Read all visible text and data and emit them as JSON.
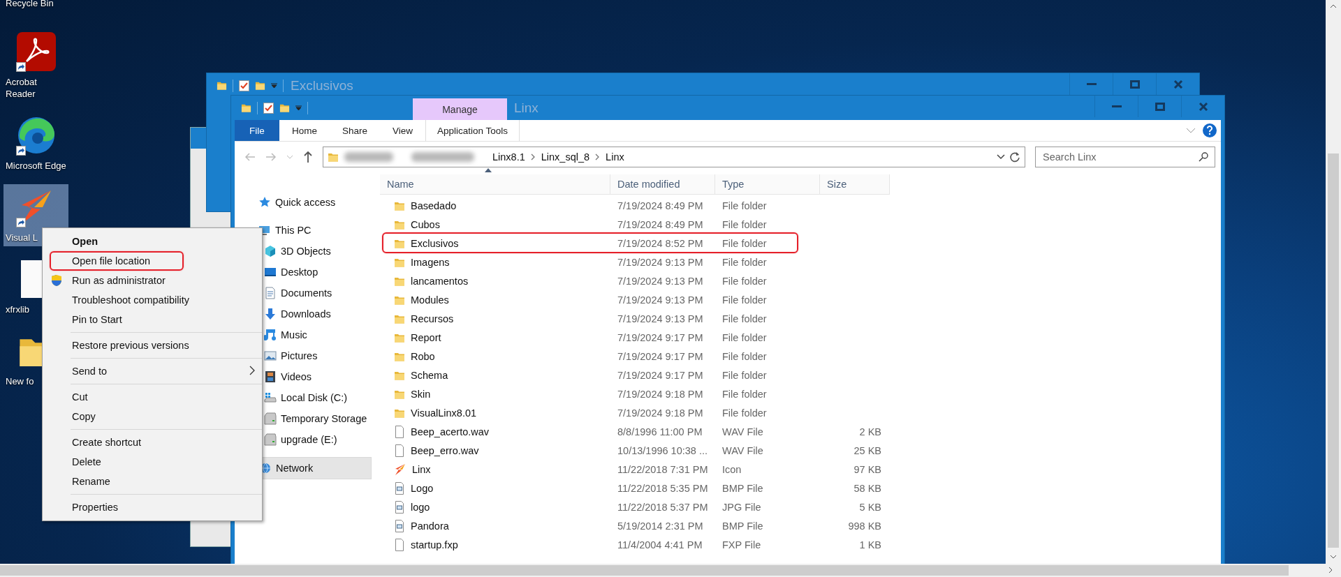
{
  "desktop": {
    "icons": [
      {
        "label": "Recycle Bin",
        "kind": "recycle",
        "selected": false
      },
      {
        "label": "Acrobat Reader",
        "kind": "acrobat",
        "selected": false
      },
      {
        "label": "Microsoft Edge",
        "kind": "edge",
        "selected": false
      },
      {
        "label": "Visual L",
        "kind": "linx",
        "selected": true
      },
      {
        "label": "xfrxlib",
        "kind": "file",
        "selected": false
      },
      {
        "label": "New fo",
        "kind": "folder",
        "selected": false
      }
    ]
  },
  "back_window": {
    "title": "Exclusivos"
  },
  "window": {
    "title": "Linx",
    "context_label": "Manage",
    "tabs": [
      {
        "label": "File",
        "kind": "file"
      },
      {
        "label": "Home",
        "kind": "tab"
      },
      {
        "label": "Share",
        "kind": "tab"
      },
      {
        "label": "View",
        "kind": "tab"
      },
      {
        "label": "Application Tools",
        "kind": "context"
      }
    ],
    "address": {
      "path": [
        "Linx8.1",
        "Linx_sql_8",
        "Linx"
      ]
    },
    "search": {
      "placeholder": "Search Linx"
    },
    "nav": [
      {
        "label": "Quick access",
        "kind": "star",
        "selected": false
      },
      {
        "label": "This PC",
        "kind": "pc",
        "selected": false,
        "children": [
          {
            "label": "3D Objects",
            "kind": "cube",
            "selected": false
          },
          {
            "label": "Desktop",
            "kind": "desktop",
            "selected": false
          },
          {
            "label": "Documents",
            "kind": "documents",
            "selected": false
          },
          {
            "label": "Downloads",
            "kind": "downloads",
            "selected": false
          },
          {
            "label": "Music",
            "kind": "music",
            "selected": false
          },
          {
            "label": "Pictures",
            "kind": "pictures",
            "selected": false
          },
          {
            "label": "Videos",
            "kind": "videos",
            "selected": false
          },
          {
            "label": "Local Disk (C:)",
            "kind": "windrive",
            "selected": false
          },
          {
            "label": "Temporary Storage",
            "kind": "drive",
            "selected": false
          },
          {
            "label": "upgrade (E:)",
            "kind": "drive",
            "selected": false
          }
        ]
      },
      {
        "label": "Network",
        "kind": "network",
        "selected": true
      }
    ],
    "table": {
      "columns": [
        "Name",
        "Date modified",
        "Type",
        "Size"
      ],
      "rows": [
        {
          "name": "Basedado",
          "date": "7/19/2024 8:49 PM",
          "type": "File folder",
          "kind": "folder",
          "highlighted": false
        },
        {
          "name": "Cubos",
          "date": "7/19/2024 8:49 PM",
          "type": "File folder",
          "kind": "folder",
          "highlighted": false
        },
        {
          "name": "Exclusivos",
          "date": "7/19/2024 8:52 PM",
          "type": "File folder",
          "kind": "folder",
          "highlighted": true
        },
        {
          "name": "Imagens",
          "date": "7/19/2024 9:13 PM",
          "type": "File folder",
          "kind": "folder",
          "highlighted": false
        },
        {
          "name": "lancamentos",
          "date": "7/19/2024 9:13 PM",
          "type": "File folder",
          "kind": "folder",
          "highlighted": false
        },
        {
          "name": "Modules",
          "date": "7/19/2024 9:13 PM",
          "type": "File folder",
          "kind": "folder",
          "highlighted": false
        },
        {
          "name": "Recursos",
          "date": "7/19/2024 9:13 PM",
          "type": "File folder",
          "kind": "folder",
          "highlighted": false
        },
        {
          "name": "Report",
          "date": "7/19/2024 9:17 PM",
          "type": "File folder",
          "kind": "folder",
          "highlighted": false
        },
        {
          "name": "Robo",
          "date": "7/19/2024 9:17 PM",
          "type": "File folder",
          "kind": "folder",
          "highlighted": false
        },
        {
          "name": "Schema",
          "date": "7/19/2024 9:17 PM",
          "type": "File folder",
          "kind": "folder",
          "highlighted": false
        },
        {
          "name": "Skin",
          "date": "7/19/2024 9:18 PM",
          "type": "File folder",
          "kind": "folder",
          "highlighted": false
        },
        {
          "name": "VisualLinx8.01",
          "date": "7/19/2024 9:18 PM",
          "type": "File folder",
          "kind": "folder",
          "highlighted": false
        },
        {
          "name": "Beep_acerto.wav",
          "date": "8/8/1996 11:00 PM",
          "type": "WAV File",
          "size": "2 KB",
          "kind": "file",
          "highlighted": false
        },
        {
          "name": "Beep_erro.wav",
          "date": "10/13/1996 10:38 ...",
          "type": "WAV File",
          "size": "25 KB",
          "kind": "file",
          "highlighted": false
        },
        {
          "name": "Linx",
          "date": "11/22/2018 7:31 PM",
          "type": "Icon",
          "size": "97 KB",
          "kind": "linx",
          "highlighted": false
        },
        {
          "name": "Logo",
          "date": "11/22/2018 5:35 PM",
          "type": "BMP File",
          "size": "58 KB",
          "kind": "image",
          "highlighted": false
        },
        {
          "name": "logo",
          "date": "11/22/2018 5:37 PM",
          "type": "JPG File",
          "size": "5 KB",
          "kind": "image",
          "highlighted": false
        },
        {
          "name": "Pandora",
          "date": "5/19/2014 2:31 PM",
          "type": "BMP File",
          "size": "998 KB",
          "kind": "image",
          "highlighted": false
        },
        {
          "name": "startup.fxp",
          "date": "11/4/2004 4:41 PM",
          "type": "FXP File",
          "size": "1 KB",
          "kind": "file",
          "highlighted": false
        }
      ]
    }
  },
  "context_menu": {
    "items": [
      {
        "label": "Open",
        "kind": "default",
        "highlighted": false
      },
      {
        "label": "Open file location",
        "kind": "item",
        "highlighted": true
      },
      {
        "label": "Run as administrator",
        "kind": "shield",
        "highlighted": false
      },
      {
        "label": "Troubleshoot compatibility",
        "kind": "item",
        "highlighted": false
      },
      {
        "label": "Pin to Start",
        "kind": "item",
        "highlighted": false
      },
      {
        "kind": "separator"
      },
      {
        "label": "Restore previous versions",
        "kind": "item",
        "highlighted": false
      },
      {
        "kind": "separator"
      },
      {
        "label": "Send to",
        "kind": "submenu",
        "highlighted": false
      },
      {
        "kind": "separator"
      },
      {
        "label": "Cut",
        "kind": "item",
        "highlighted": false
      },
      {
        "label": "Copy",
        "kind": "item",
        "highlighted": false
      },
      {
        "kind": "separator"
      },
      {
        "label": "Create shortcut",
        "kind": "item",
        "highlighted": false
      },
      {
        "label": "Delete",
        "kind": "item",
        "highlighted": false
      },
      {
        "label": "Rename",
        "kind": "item",
        "highlighted": false
      },
      {
        "kind": "separator"
      },
      {
        "label": "Properties",
        "kind": "item",
        "highlighted": false
      }
    ]
  }
}
